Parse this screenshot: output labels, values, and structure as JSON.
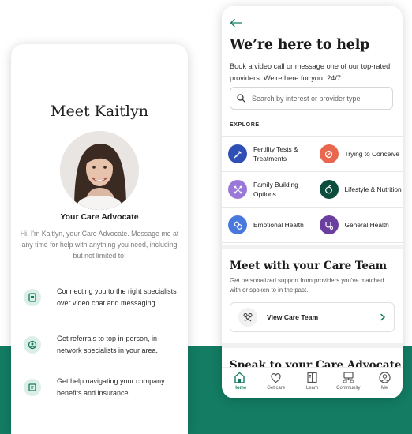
{
  "colors": {
    "brand_green": "#137c63",
    "mint": "#dcefe6"
  },
  "left_screen": {
    "title": "Meet Kaitlyn",
    "role": "Your Care Advocate",
    "intro": "Hi, I'm Kaitlyn, your Care Advocate. Message me at any time for help with anything you need, including but not limited to:",
    "features": [
      {
        "icon": "video-chat-icon",
        "text": "Connecting you to the right specialists over video chat and messaging."
      },
      {
        "icon": "referral-icon",
        "text": "Get referrals to top in-person, in-network specialists in your area."
      },
      {
        "icon": "benefits-icon",
        "text": "Get help navigating your company benefits and insurance."
      }
    ]
  },
  "right_screen": {
    "title": "We’re here to help",
    "subtitle": "Book a video call or message one of our top-rated providers. We're here for you, 24/7.",
    "search_placeholder": "Search by interest or provider type",
    "explore_label": "EXPLORE",
    "categories": [
      {
        "label": "Fertility Tests & Treatments",
        "icon": "syringe-icon",
        "color": "#2f4fb4"
      },
      {
        "label": "Trying to Conceive",
        "icon": "egg-icon",
        "color": "#e8674e"
      },
      {
        "label": "Family Building Options",
        "icon": "family-icon",
        "color": "#9a78d8"
      },
      {
        "label": "Lifestyle & Nutrition",
        "icon": "nutrition-icon",
        "color": "#0d4d3e"
      },
      {
        "label": "Emotional Health",
        "icon": "emotional-icon",
        "color": "#4a79dd"
      },
      {
        "label": "General Health",
        "icon": "stethoscope-icon",
        "color": "#6b3fa0"
      }
    ],
    "care_team_title": "Meet with your Care Team",
    "care_team_subtitle": "Get personalized support from providers you've matched with or spoken to in the past.",
    "view_care_team": "View Care Team",
    "speak_title": "Speak to your Care Advocate",
    "tabs": [
      {
        "label": "Home",
        "icon": "home-icon",
        "active": true
      },
      {
        "label": "Get care",
        "icon": "heart-icon",
        "active": false
      },
      {
        "label": "Learn",
        "icon": "book-icon",
        "active": false
      },
      {
        "label": "Community",
        "icon": "community-icon",
        "active": false
      },
      {
        "label": "Me",
        "icon": "profile-icon",
        "active": false
      }
    ]
  }
}
